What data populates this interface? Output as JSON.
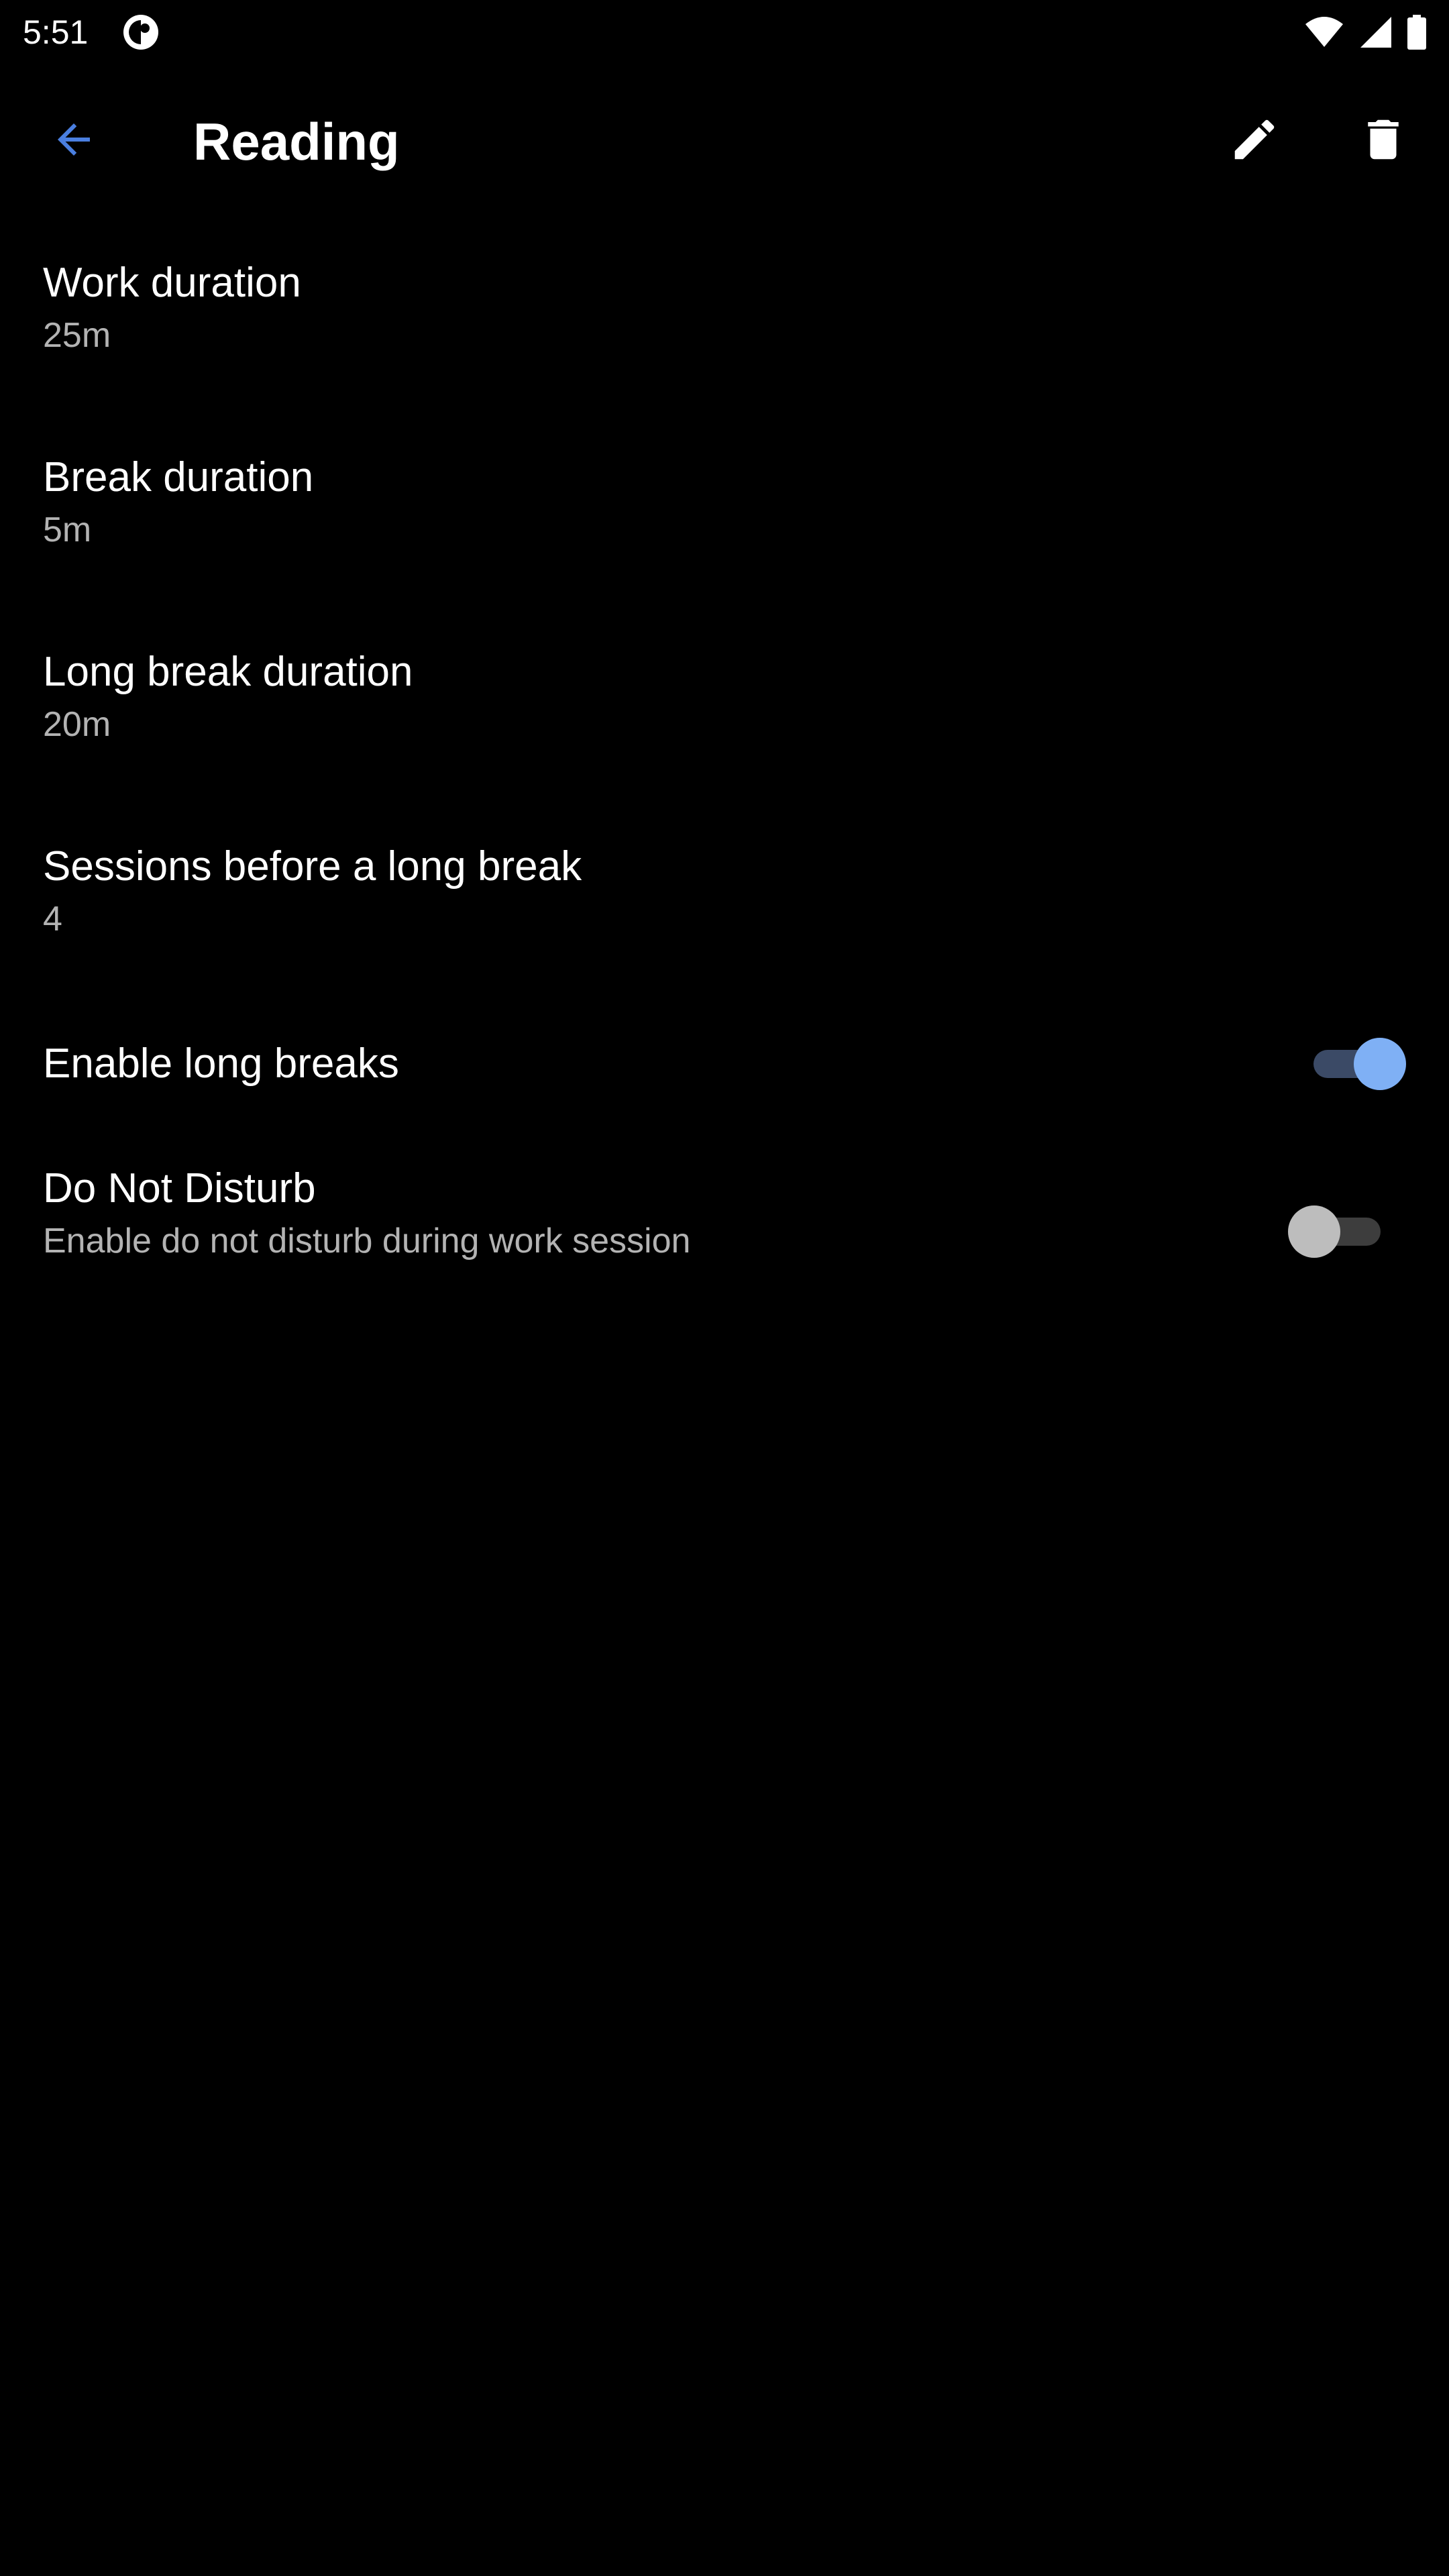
{
  "status_bar": {
    "time": "5:51",
    "icons": [
      "app-notification-icon",
      "wifi-icon",
      "signal-icon",
      "battery-icon"
    ]
  },
  "toolbar": {
    "title": "Reading",
    "back_icon": "arrow-left-icon",
    "edit_icon": "pencil-icon",
    "delete_icon": "trash-icon"
  },
  "colors": {
    "background": "#000000",
    "accent": "#4a7fe0",
    "switch_on_thumb": "#7fb0f5",
    "switch_on_track": "#3b4a66",
    "switch_off_thumb": "#bdbdbd",
    "switch_off_track": "#3d3d3d",
    "summary_text": "#b3b3b3"
  },
  "preferences": {
    "work_duration": {
      "title": "Work duration",
      "summary": "25m"
    },
    "break_duration": {
      "title": "Break duration",
      "summary": "5m"
    },
    "long_break_duration": {
      "title": "Long break duration",
      "summary": "20m"
    },
    "sessions_before_long_break": {
      "title": "Sessions before a long break",
      "summary": "4"
    },
    "enable_long_breaks": {
      "title": "Enable long breaks",
      "checked": true
    },
    "do_not_disturb": {
      "title": "Do Not Disturb",
      "summary": "Enable do not disturb during work session",
      "checked": false
    }
  }
}
